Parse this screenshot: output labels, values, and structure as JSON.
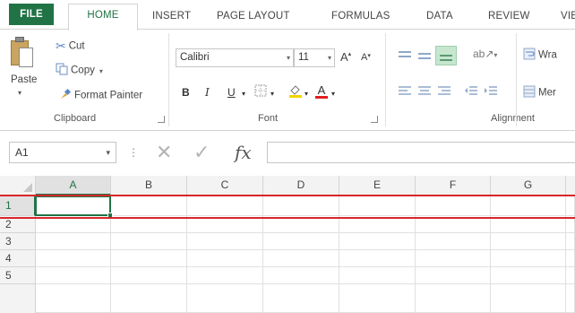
{
  "tabs": [
    "FILE",
    "HOME",
    "INSERT",
    "PAGE LAYOUT",
    "FORMULAS",
    "DATA",
    "REVIEW",
    "VIE"
  ],
  "clipboard": {
    "paste": "Paste",
    "cut": "Cut",
    "copy": "Copy",
    "format_painter": "Format Painter",
    "group_label": "Clipboard"
  },
  "font": {
    "name": "Calibri",
    "size": "11",
    "grow": "A",
    "shrink": "A",
    "bold": "B",
    "italic": "I",
    "underline": "U",
    "font_color_letter": "A",
    "group_label": "Font"
  },
  "alignment": {
    "wrap": "Wra",
    "merge": "Mer",
    "group_label": "Alignment"
  },
  "formula_bar": {
    "name_box": "A1",
    "fx": "fx",
    "formula_value": ""
  },
  "grid": {
    "columns": [
      "A",
      "B",
      "C",
      "D",
      "E",
      "F",
      "G"
    ],
    "rows": [
      "1",
      "2",
      "3",
      "4",
      "5"
    ],
    "selected_cell": "A1"
  },
  "colors": {
    "accent": "#217346",
    "highlight_line": "#d9262c"
  }
}
